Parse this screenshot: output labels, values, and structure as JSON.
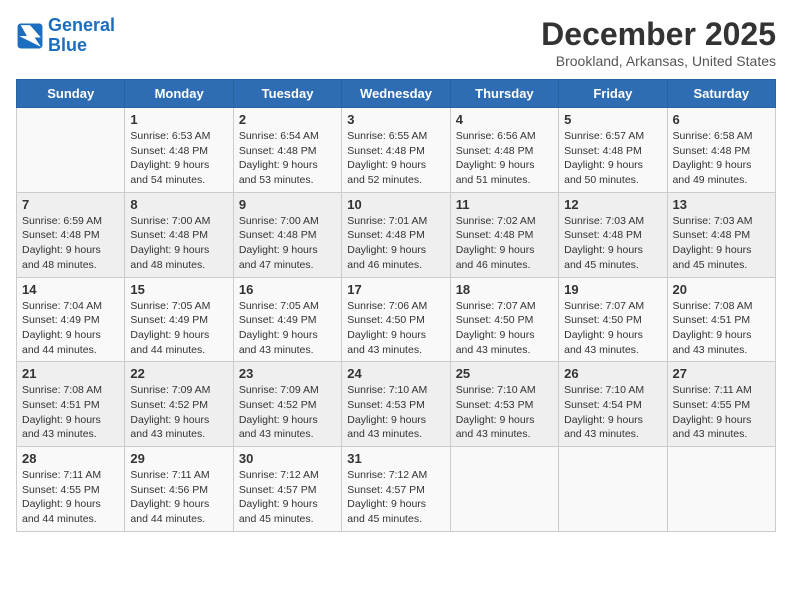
{
  "logo": {
    "line1": "General",
    "line2": "Blue"
  },
  "title": "December 2025",
  "location": "Brookland, Arkansas, United States",
  "days_of_week": [
    "Sunday",
    "Monday",
    "Tuesday",
    "Wednesday",
    "Thursday",
    "Friday",
    "Saturday"
  ],
  "weeks": [
    [
      {
        "day": "",
        "sunrise": "",
        "sunset": "",
        "daylight": ""
      },
      {
        "day": "1",
        "sunrise": "Sunrise: 6:53 AM",
        "sunset": "Sunset: 4:48 PM",
        "daylight": "Daylight: 9 hours and 54 minutes."
      },
      {
        "day": "2",
        "sunrise": "Sunrise: 6:54 AM",
        "sunset": "Sunset: 4:48 PM",
        "daylight": "Daylight: 9 hours and 53 minutes."
      },
      {
        "day": "3",
        "sunrise": "Sunrise: 6:55 AM",
        "sunset": "Sunset: 4:48 PM",
        "daylight": "Daylight: 9 hours and 52 minutes."
      },
      {
        "day": "4",
        "sunrise": "Sunrise: 6:56 AM",
        "sunset": "Sunset: 4:48 PM",
        "daylight": "Daylight: 9 hours and 51 minutes."
      },
      {
        "day": "5",
        "sunrise": "Sunrise: 6:57 AM",
        "sunset": "Sunset: 4:48 PM",
        "daylight": "Daylight: 9 hours and 50 minutes."
      },
      {
        "day": "6",
        "sunrise": "Sunrise: 6:58 AM",
        "sunset": "Sunset: 4:48 PM",
        "daylight": "Daylight: 9 hours and 49 minutes."
      }
    ],
    [
      {
        "day": "7",
        "sunrise": "Sunrise: 6:59 AM",
        "sunset": "Sunset: 4:48 PM",
        "daylight": "Daylight: 9 hours and 48 minutes."
      },
      {
        "day": "8",
        "sunrise": "Sunrise: 7:00 AM",
        "sunset": "Sunset: 4:48 PM",
        "daylight": "Daylight: 9 hours and 48 minutes."
      },
      {
        "day": "9",
        "sunrise": "Sunrise: 7:00 AM",
        "sunset": "Sunset: 4:48 PM",
        "daylight": "Daylight: 9 hours and 47 minutes."
      },
      {
        "day": "10",
        "sunrise": "Sunrise: 7:01 AM",
        "sunset": "Sunset: 4:48 PM",
        "daylight": "Daylight: 9 hours and 46 minutes."
      },
      {
        "day": "11",
        "sunrise": "Sunrise: 7:02 AM",
        "sunset": "Sunset: 4:48 PM",
        "daylight": "Daylight: 9 hours and 46 minutes."
      },
      {
        "day": "12",
        "sunrise": "Sunrise: 7:03 AM",
        "sunset": "Sunset: 4:48 PM",
        "daylight": "Daylight: 9 hours and 45 minutes."
      },
      {
        "day": "13",
        "sunrise": "Sunrise: 7:03 AM",
        "sunset": "Sunset: 4:48 PM",
        "daylight": "Daylight: 9 hours and 45 minutes."
      }
    ],
    [
      {
        "day": "14",
        "sunrise": "Sunrise: 7:04 AM",
        "sunset": "Sunset: 4:49 PM",
        "daylight": "Daylight: 9 hours and 44 minutes."
      },
      {
        "day": "15",
        "sunrise": "Sunrise: 7:05 AM",
        "sunset": "Sunset: 4:49 PM",
        "daylight": "Daylight: 9 hours and 44 minutes."
      },
      {
        "day": "16",
        "sunrise": "Sunrise: 7:05 AM",
        "sunset": "Sunset: 4:49 PM",
        "daylight": "Daylight: 9 hours and 43 minutes."
      },
      {
        "day": "17",
        "sunrise": "Sunrise: 7:06 AM",
        "sunset": "Sunset: 4:50 PM",
        "daylight": "Daylight: 9 hours and 43 minutes."
      },
      {
        "day": "18",
        "sunrise": "Sunrise: 7:07 AM",
        "sunset": "Sunset: 4:50 PM",
        "daylight": "Daylight: 9 hours and 43 minutes."
      },
      {
        "day": "19",
        "sunrise": "Sunrise: 7:07 AM",
        "sunset": "Sunset: 4:50 PM",
        "daylight": "Daylight: 9 hours and 43 minutes."
      },
      {
        "day": "20",
        "sunrise": "Sunrise: 7:08 AM",
        "sunset": "Sunset: 4:51 PM",
        "daylight": "Daylight: 9 hours and 43 minutes."
      }
    ],
    [
      {
        "day": "21",
        "sunrise": "Sunrise: 7:08 AM",
        "sunset": "Sunset: 4:51 PM",
        "daylight": "Daylight: 9 hours and 43 minutes."
      },
      {
        "day": "22",
        "sunrise": "Sunrise: 7:09 AM",
        "sunset": "Sunset: 4:52 PM",
        "daylight": "Daylight: 9 hours and 43 minutes."
      },
      {
        "day": "23",
        "sunrise": "Sunrise: 7:09 AM",
        "sunset": "Sunset: 4:52 PM",
        "daylight": "Daylight: 9 hours and 43 minutes."
      },
      {
        "day": "24",
        "sunrise": "Sunrise: 7:10 AM",
        "sunset": "Sunset: 4:53 PM",
        "daylight": "Daylight: 9 hours and 43 minutes."
      },
      {
        "day": "25",
        "sunrise": "Sunrise: 7:10 AM",
        "sunset": "Sunset: 4:53 PM",
        "daylight": "Daylight: 9 hours and 43 minutes."
      },
      {
        "day": "26",
        "sunrise": "Sunrise: 7:10 AM",
        "sunset": "Sunset: 4:54 PM",
        "daylight": "Daylight: 9 hours and 43 minutes."
      },
      {
        "day": "27",
        "sunrise": "Sunrise: 7:11 AM",
        "sunset": "Sunset: 4:55 PM",
        "daylight": "Daylight: 9 hours and 43 minutes."
      }
    ],
    [
      {
        "day": "28",
        "sunrise": "Sunrise: 7:11 AM",
        "sunset": "Sunset: 4:55 PM",
        "daylight": "Daylight: 9 hours and 44 minutes."
      },
      {
        "day": "29",
        "sunrise": "Sunrise: 7:11 AM",
        "sunset": "Sunset: 4:56 PM",
        "daylight": "Daylight: 9 hours and 44 minutes."
      },
      {
        "day": "30",
        "sunrise": "Sunrise: 7:12 AM",
        "sunset": "Sunset: 4:57 PM",
        "daylight": "Daylight: 9 hours and 45 minutes."
      },
      {
        "day": "31",
        "sunrise": "Sunrise: 7:12 AM",
        "sunset": "Sunset: 4:57 PM",
        "daylight": "Daylight: 9 hours and 45 minutes."
      },
      {
        "day": "",
        "sunrise": "",
        "sunset": "",
        "daylight": ""
      },
      {
        "day": "",
        "sunrise": "",
        "sunset": "",
        "daylight": ""
      },
      {
        "day": "",
        "sunrise": "",
        "sunset": "",
        "daylight": ""
      }
    ]
  ]
}
